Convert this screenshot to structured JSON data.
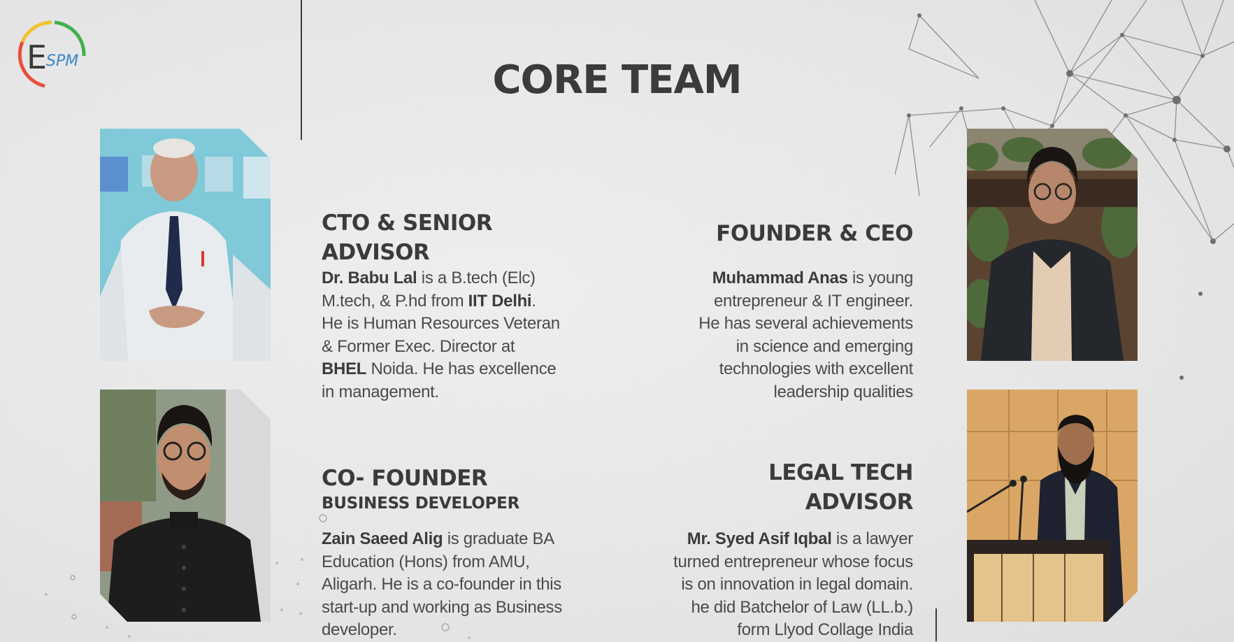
{
  "logo": {
    "text": "ESPM",
    "colors": [
      "#e94e3c",
      "#f2c12e",
      "#41b04b",
      "#3a87c8"
    ]
  },
  "page_title": "CORE TEAM",
  "members": [
    {
      "role": "CTO & SENIOR",
      "role_line2": "ADVISOR",
      "bio": {
        "l1_name": "Dr. Babu Lal",
        "l1_rest": " is a B.tech (Elc)",
        "l2_pre": "M.tech, & P.hd from ",
        "l2_bold": "IIT Delhi",
        "l2_post": ".",
        "l3": "He is Human Resources Veteran",
        "l4": "& Former Exec. Director at",
        "l5_bold": "BHEL",
        "l5_rest": " Noida. He has excellence",
        "l6": "in management."
      }
    },
    {
      "role": "FOUNDER & CEO",
      "bio": {
        "l1_name": "Muhammad Anas",
        "l1_rest": " is young",
        "l2": "entrepreneur &  IT engineer.",
        "l3": "He has several achievements",
        "l4": "in science and emerging",
        "l5": "technologies with excellent",
        "l6": "leadership qualities"
      }
    },
    {
      "role": "CO- FOUNDER",
      "subrole": "BUSINESS DEVELOPER",
      "bio": {
        "l1_name": "Zain Saeed Alig",
        "l1_rest": " is graduate  BA",
        "l2": "Education (Hons) from AMU,",
        "l3": "Aligarh. He is a co-founder in this",
        "l4": "start-up and working as Business",
        "l5": "developer."
      }
    },
    {
      "role": "LEGAL TECH",
      "role_line2": "ADVISOR",
      "bio": {
        "l1_name": "Mr. Syed Asif Iqbal",
        "l1_rest": " is a lawyer",
        "l2": "turned entrepreneur whose focus",
        "l3": "is on innovation in legal domain.",
        "l4": "he did Batchelor of Law (LL.b.)",
        "l5": "form Llyod Collage India"
      }
    }
  ],
  "colors": {
    "text": "#3b3b3b",
    "background": "#e8e8e8",
    "network_lines": "#8a8a8a"
  }
}
